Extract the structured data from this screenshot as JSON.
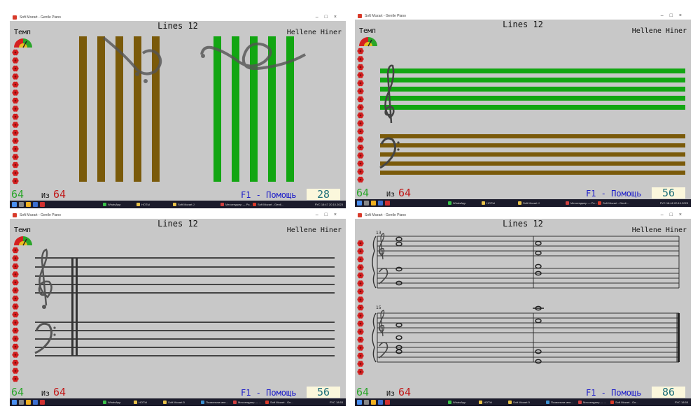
{
  "windows": [
    {
      "app_title": "Soft Mozart - Gentle Piano",
      "title": "Lines 12",
      "author": "Hellene Hiner",
      "tempo_label": "Темп",
      "count": "64",
      "of_label": "Из",
      "total": "64",
      "help": "F1 - Помощь",
      "score": "28",
      "taskbar": {
        "items": [
          "WhatsApp",
          "НОТЫ",
          "Soft Mozart J",
          "Мессенджер — Ро...",
          "Soft Mozart - Gentl..."
        ],
        "tray": "РУС",
        "time": "18:47",
        "date": "20.10.2023"
      }
    },
    {
      "app_title": "Soft Mozart - Gentle Piano",
      "title": "Lines 12",
      "author": "Hellene Hiner",
      "tempo_label": "Темп",
      "count": "64",
      "of_label": "Из",
      "total": "64",
      "help": "F1 - Помощь",
      "score": "56",
      "taskbar": {
        "items": [
          "WhatsApp",
          "НОТЫ",
          "Soft Mozart J",
          "Мессенджер — Ро...",
          "Soft Mozart - Gentl..."
        ],
        "tray": "РУС",
        "time": "18:48",
        "date": "20.10.2023"
      }
    },
    {
      "app_title": "Soft Mozart - Gentle Piano",
      "title": "Lines 12",
      "author": "Hellene Hiner",
      "tempo_label": "Темп",
      "count": "64",
      "of_label": "Из",
      "total": "64",
      "help": "F1 - Помощь",
      "score": "56",
      "taskbar": {
        "items": [
          "WhatsApp",
          "НОТЫ",
          "Soft Mozart 5",
          "Позвонили мне...",
          "Мессенджер — ...",
          "Soft Mozart - Ge..."
        ],
        "tray": "РУС",
        "time": "18:53",
        "date": "20.10.2023"
      }
    },
    {
      "app_title": "Soft Mozart - Gentle Piano",
      "title": "Lines 12",
      "author": "Hellene Hiner",
      "tempo_label": "Темп",
      "count": "64",
      "of_label": "Из",
      "total": "64",
      "help": "F1 - Помощь",
      "score": "86",
      "measure_numbers": [
        "13",
        "15"
      ],
      "taskbar": {
        "items": [
          "WhatsApp",
          "НОТЫ",
          "Soft Mozart 5",
          "Позвонили мне...",
          "Мессенджер — ...",
          "Soft Mozart - Ge..."
        ],
        "tray": "РУС",
        "time": "18:55",
        "date": "20.10.2023"
      }
    }
  ],
  "colors": {
    "green_line": "#12a612",
    "brown_line": "#7a5a0a",
    "staff_line": "#3a3a3a",
    "background": "#c8c8c8",
    "count_green": "#2aa52a",
    "total_red": "#c01818",
    "help_blue": "#1c1cc8",
    "score_teal": "#1f6f7a",
    "score_bg": "#fbf7dc"
  },
  "icons": {
    "tempo": "tempo-speedometer-icon",
    "flower": "red-flower-icon",
    "treble": "treble-clef-icon",
    "bass": "bass-clef-icon"
  }
}
